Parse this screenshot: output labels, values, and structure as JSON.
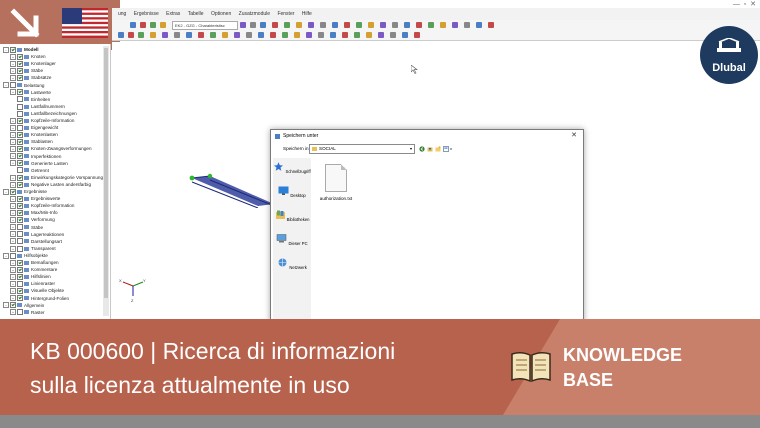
{
  "corner": {
    "accent": "#b6705e",
    "arrow_icon": "arrow-down-right-icon",
    "flag_icon": "us-flag-icon"
  },
  "menu": [
    "ung",
    "Ergebnisse",
    "Extras",
    "Tabelle",
    "Optionen",
    "Zusatzmodule",
    "Fenster",
    "Hilfe"
  ],
  "toolbar": {
    "combo": "EK2 - GZG - Charakteristisc"
  },
  "nav": {
    "items": [
      {
        "label": "Modell",
        "level": 0,
        "bold": true,
        "checked": true
      },
      {
        "label": "Knoten",
        "level": 1,
        "checked": true
      },
      {
        "label": "Knotenlager",
        "level": 1,
        "checked": true
      },
      {
        "label": "Stäbe",
        "level": 1,
        "checked": true
      },
      {
        "label": "Stabsätze",
        "level": 1,
        "checked": true
      },
      {
        "label": "Belastung",
        "level": 0,
        "checked": false
      },
      {
        "label": "Lastwerte",
        "level": 1,
        "checked": true
      },
      {
        "label": "Einheiten",
        "level": 2,
        "checked": false
      },
      {
        "label": "Lastfallnummern",
        "level": 2,
        "checked": false
      },
      {
        "label": "Lastfallbezeichnungen",
        "level": 2,
        "checked": false
      },
      {
        "label": "Kopfzeile-Information",
        "level": 1,
        "checked": true
      },
      {
        "label": "Eigengewicht",
        "level": 1,
        "checked": false
      },
      {
        "label": "Knotenlasten",
        "level": 1,
        "checked": true
      },
      {
        "label": "Stablasten",
        "level": 1,
        "checked": true
      },
      {
        "label": "Knoten-Zwangsverformungen",
        "level": 1,
        "checked": true
      },
      {
        "label": "Imperfektionen",
        "level": 1,
        "checked": true
      },
      {
        "label": "Generierte Lasten",
        "level": 1,
        "checked": true
      },
      {
        "label": "Getrennt",
        "level": 2,
        "checked": false
      },
      {
        "label": "Einwirkungskategorie Vorspannung",
        "level": 1,
        "checked": true
      },
      {
        "label": "Negative Lasten andersfarbig",
        "level": 1,
        "checked": true
      },
      {
        "label": "Ergebnisse",
        "level": 0,
        "checked": true
      },
      {
        "label": "Ergebniswerte",
        "level": 1,
        "checked": true
      },
      {
        "label": "Kopfzeile-Information",
        "level": 1,
        "checked": true
      },
      {
        "label": "Max/Min-Info",
        "level": 1,
        "checked": true
      },
      {
        "label": "Verformung",
        "level": 1,
        "checked": true
      },
      {
        "label": "Stäbe",
        "level": 1,
        "checked": false
      },
      {
        "label": "Lagerreaktionen",
        "level": 1,
        "checked": false
      },
      {
        "label": "Darstellungsart",
        "level": 1,
        "checked": false
      },
      {
        "label": "Transparent",
        "level": 1,
        "checked": false
      },
      {
        "label": "Hilfsobjekte",
        "level": 0,
        "checked": false
      },
      {
        "label": "Bemaßungen",
        "level": 1,
        "checked": true
      },
      {
        "label": "Kommentare",
        "level": 1,
        "checked": true
      },
      {
        "label": "Hilfslinien",
        "level": 1,
        "checked": true
      },
      {
        "label": "Linienraster",
        "level": 1,
        "checked": false
      },
      {
        "label": "Visuelle Objekte",
        "level": 1,
        "checked": true
      },
      {
        "label": "Hintergrund-Folien",
        "level": 1,
        "checked": true
      },
      {
        "label": "Allgemein",
        "level": 0,
        "checked": true
      },
      {
        "label": "Raster",
        "level": 1,
        "checked": false
      }
    ]
  },
  "dialog": {
    "title": "Speichern unter",
    "lookin_label": "Speichern in:",
    "lookin_value": "SOCIAL",
    "places": [
      {
        "label": "Schnellzugriff",
        "icon": "star-icon"
      },
      {
        "label": "Desktop",
        "icon": "desktop-icon"
      },
      {
        "label": "Bibliotheken",
        "icon": "library-icon"
      },
      {
        "label": "Dieser PC",
        "icon": "computer-icon"
      },
      {
        "label": "Netzwerk",
        "icon": "network-icon"
      }
    ],
    "file": {
      "name": "authorization.txt",
      "icon": "text-file-icon"
    }
  },
  "axes": {
    "x": "X",
    "y": "Y",
    "z": "Z"
  },
  "logo": {
    "text": "Dlubal",
    "color": "#1f3a5f"
  },
  "banner": {
    "line1": "KB 000600 | Ricerca di informazioni",
    "line2": "sulla licenza attualmente in uso",
    "kb1": "KNOWLEDGE",
    "kb2": "BASE",
    "book_icon": "open-book-icon",
    "color_left": "#b7624d",
    "color_right": "#c9806b"
  }
}
